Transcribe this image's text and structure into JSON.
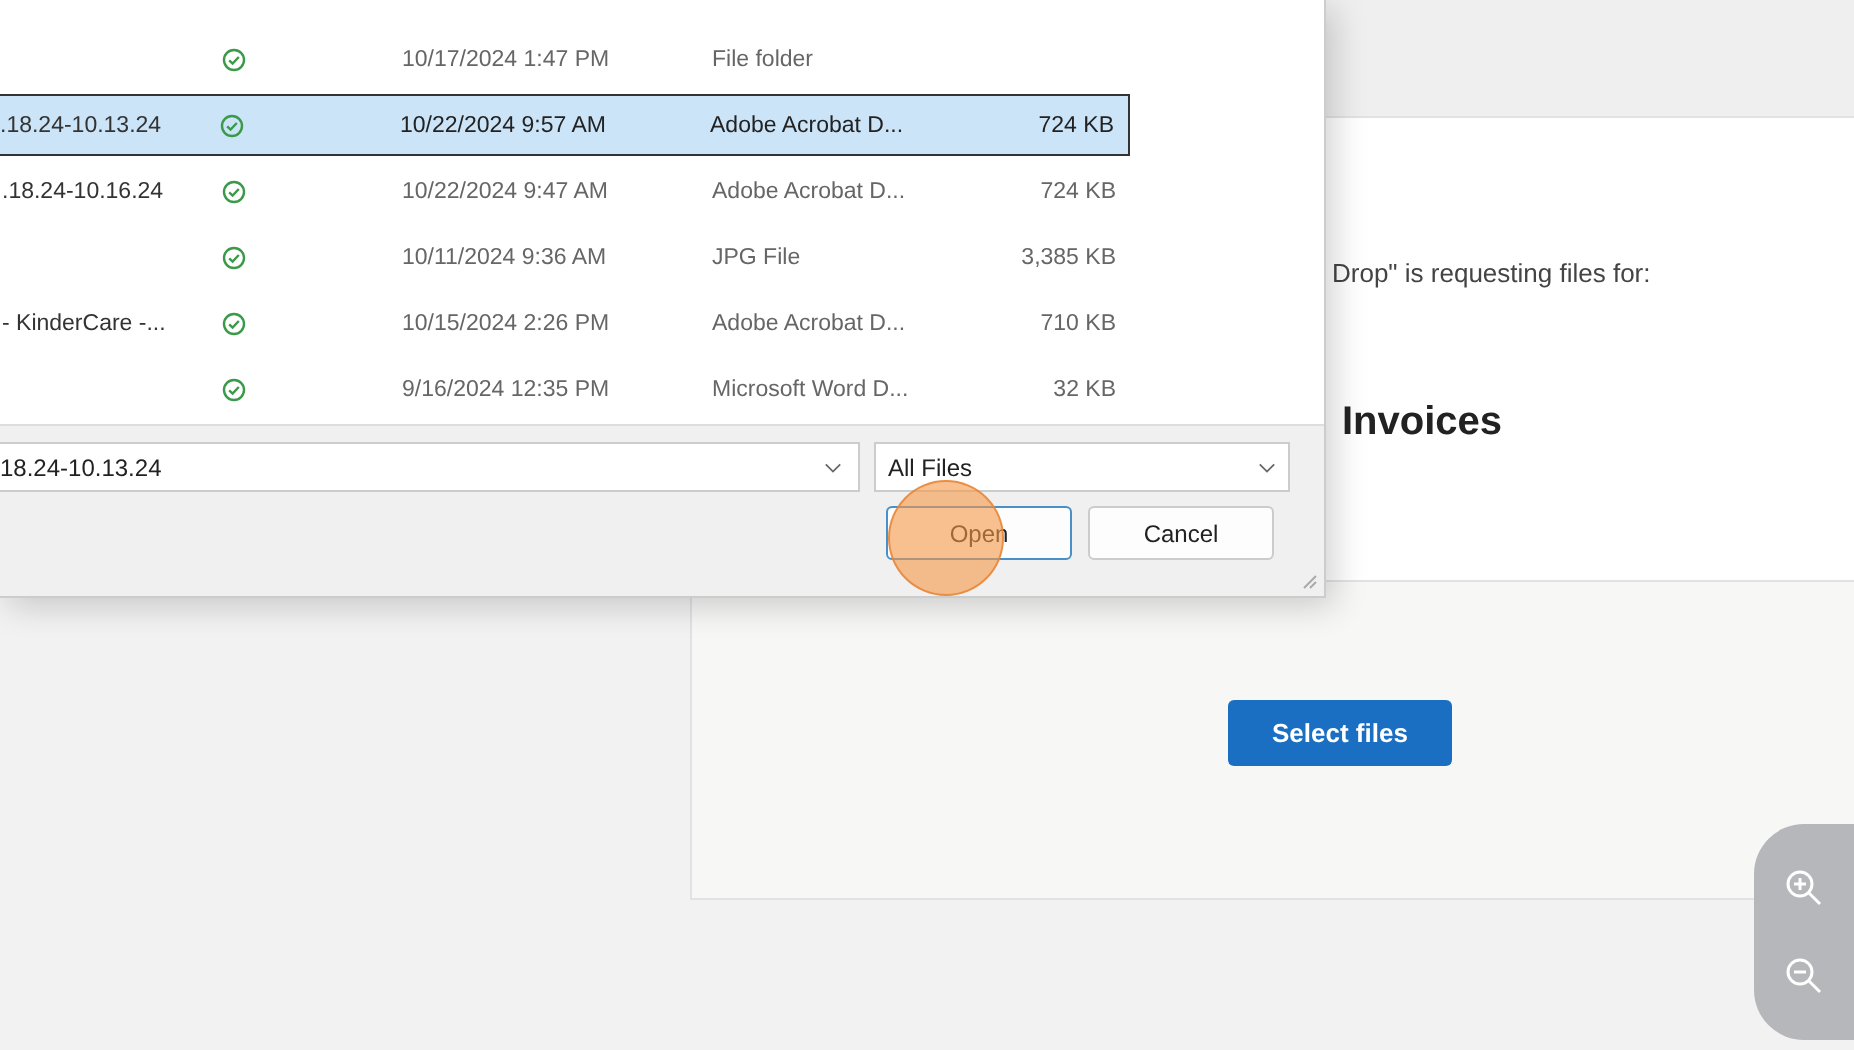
{
  "dialog": {
    "files": [
      {
        "synced": true,
        "date": "10/17/2024 1:47 PM",
        "type": "File folder",
        "selected": false
      },
      {
        "name": ".18.24-10.13.24",
        "synced": true,
        "date": "10/22/2024 9:57 AM",
        "type": "Adobe Acrobat D...",
        "size": "724 KB",
        "selected": true
      },
      {
        "name": ".18.24-10.16.24",
        "synced": true,
        "date": "10/22/2024 9:47 AM",
        "type": "Adobe Acrobat D...",
        "size": "724 KB",
        "selected": false
      },
      {
        "synced": true,
        "date": "10/11/2024 9:36 AM",
        "type": "JPG File",
        "size": "3,385 KB",
        "selected": false
      },
      {
        "name": "- KinderCare -...",
        "synced": true,
        "date": "10/15/2024 2:26 PM",
        "type": "Adobe Acrobat D...",
        "size": "710 KB",
        "selected": false
      },
      {
        "synced": true,
        "date": "9/16/2024 12:35 PM",
        "type": "Microsoft Word D...",
        "size": "32 KB",
        "selected": false
      }
    ],
    "filename": "18.24-10.13.24",
    "filter": "All Files",
    "buttons": [
      {
        "label": "Open",
        "focused": true
      },
      {
        "label": "Cancel",
        "focused": false
      }
    ]
  },
  "page": {
    "request_text": "Drop\" is requesting files for:",
    "heading": "Invoices",
    "select_button": "Select files"
  }
}
